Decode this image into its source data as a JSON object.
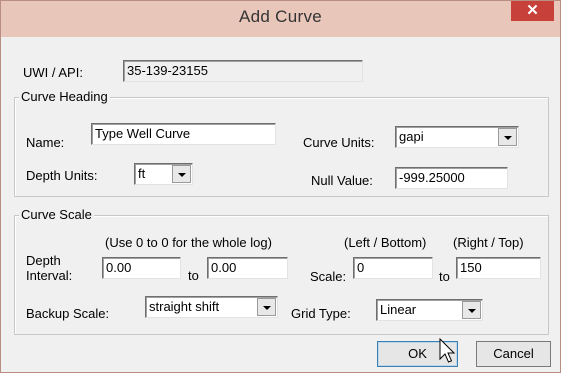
{
  "window": {
    "title": "Add Curve",
    "close_label": "✕"
  },
  "uwi": {
    "label": "UWI / API:",
    "value": "35-139-23155"
  },
  "curve_heading": {
    "group_label": "Curve Heading",
    "name_label": "Name:",
    "name_value": "Type Well Curve",
    "curve_units_label": "Curve Units:",
    "curve_units_value": "gapi",
    "depth_units_label": "Depth Units:",
    "depth_units_value": "ft",
    "null_value_label": "Null Value:",
    "null_value": "-999.25000"
  },
  "curve_scale": {
    "group_label": "Curve Scale",
    "depth_hint": "(Use 0 to 0 for the whole log)",
    "depth_label_line1": "Depth",
    "depth_label_line2": "Interval:",
    "depth_from": "0.00",
    "to_label_1": "to",
    "depth_to": "0.00",
    "left_bottom_label": "(Left / Bottom)",
    "right_top_label": "(Right / Top)",
    "scale_label": "Scale:",
    "scale_left": "0",
    "to_label_2": "to",
    "scale_right": "150",
    "backup_scale_label": "Backup Scale:",
    "backup_scale_value": "straight shift",
    "grid_type_label": "Grid Type:",
    "grid_type_value": "Linear"
  },
  "buttons": {
    "ok_label": "OK",
    "cancel_label": "Cancel"
  },
  "icons": {
    "close": "close-icon",
    "cursor": "mouse-pointer-icon",
    "dropdown": "chevron-down-icon"
  }
}
